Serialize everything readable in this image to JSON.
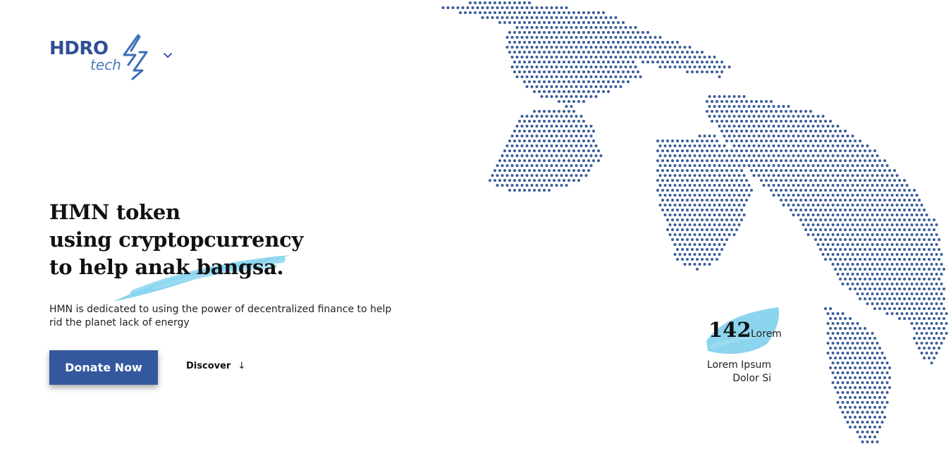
{
  "logo": {
    "word1": "HDRO",
    "word2": "tech",
    "icon": "lightning-bolt-icon",
    "menu_icon": "chevron-down-icon"
  },
  "hero": {
    "title_lines": [
      "HMN token",
      "using cryptopcurrency",
      "to help anak bangsa."
    ],
    "description": "HMN is dedicated to using the power of decentralized finance to help rid the planet lack of energy",
    "donate_label": "Donate Now",
    "discover_label": "Discover",
    "discover_icon": "arrow-down-icon"
  },
  "stat": {
    "number": "142",
    "unit": "Lorem",
    "caption_lines": [
      "Lorem Ipsum",
      "Dolor Si"
    ]
  },
  "colors": {
    "brand": "#34589e",
    "map_dots": "#3a5d99",
    "brush": "#7fd0ec",
    "text": "#111111"
  }
}
